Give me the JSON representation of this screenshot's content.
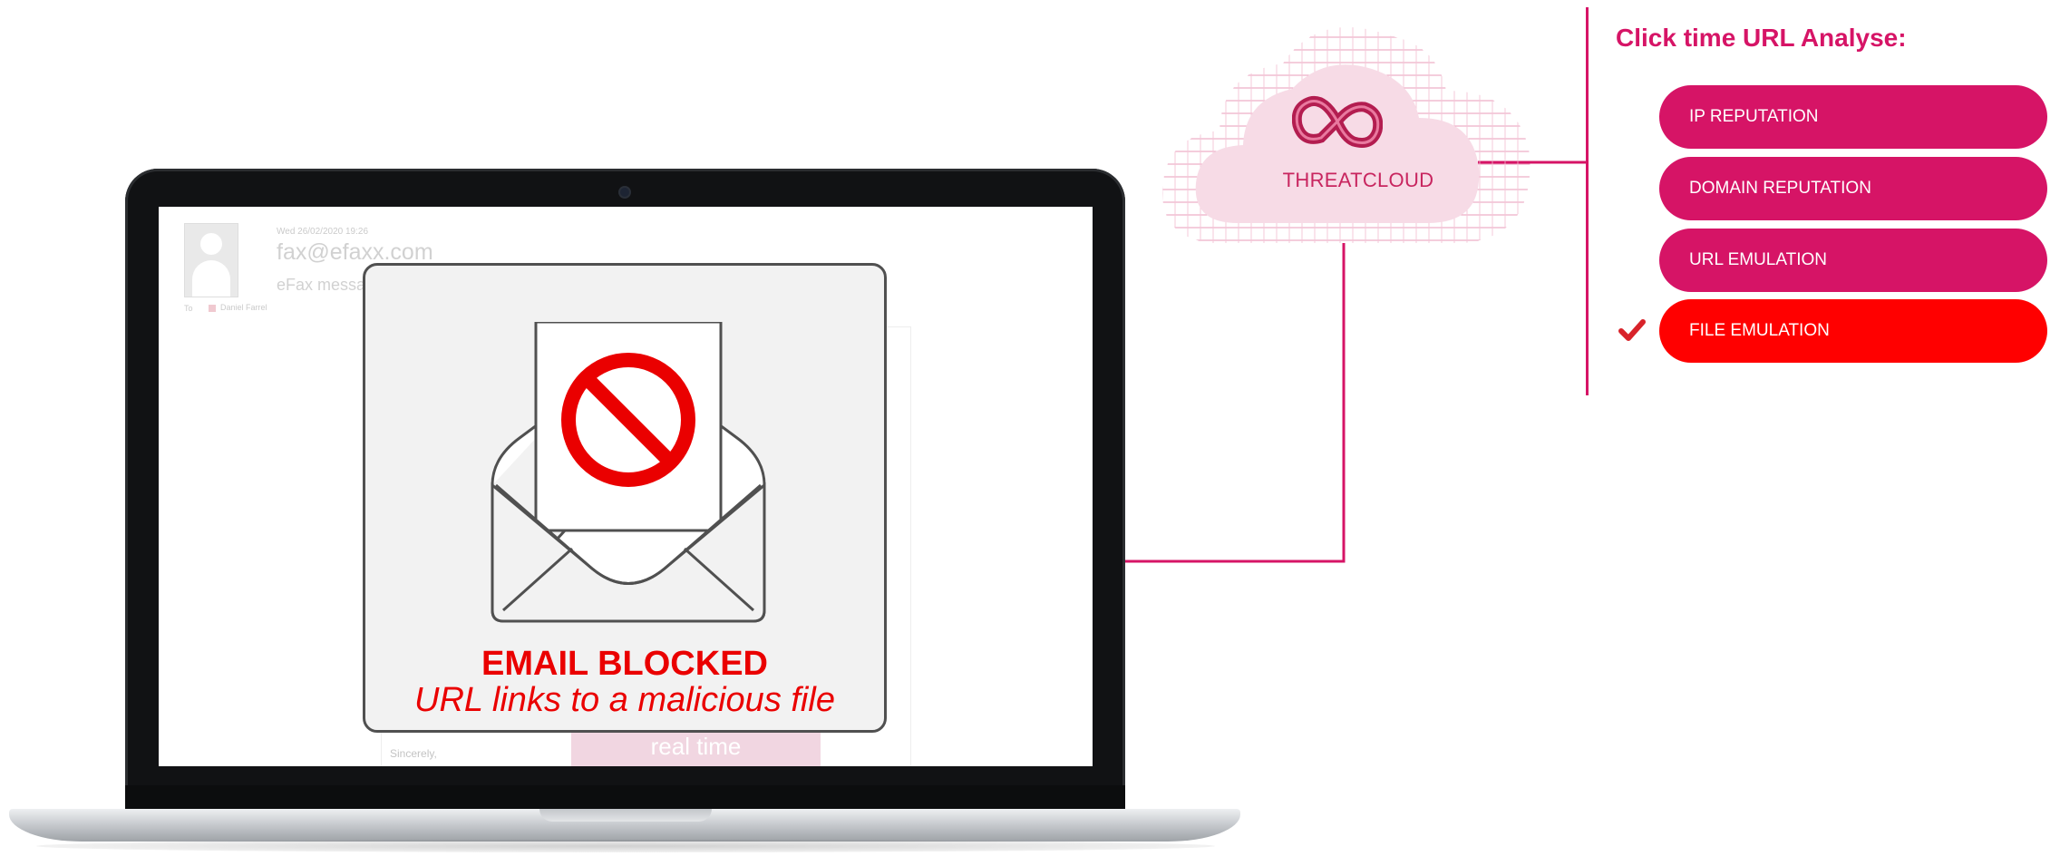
{
  "email": {
    "date": "Wed 26/02/2020 19:26",
    "from": "fax@efaxx.com",
    "subject": "eFax message",
    "to_label": "To",
    "to_name": "Daniel Farrel",
    "sign_off": "Sincerely,",
    "button_label": "real time"
  },
  "overlay": {
    "title": "EMAIL BLOCKED",
    "subtitle": "URL links to a malicious file"
  },
  "cloud": {
    "label": "THREATCLOUD"
  },
  "panel": {
    "title": "Click time URL Analyse:",
    "items": [
      {
        "label": "IP REPUTATION",
        "color": "#d61466",
        "checked": false
      },
      {
        "label": "DOMAIN REPUTATION",
        "color": "#d61466",
        "checked": false
      },
      {
        "label": "URL EMULATION",
        "color": "#d61466",
        "checked": false
      },
      {
        "label": "FILE EMULATION",
        "color": "#ff0000",
        "checked": true
      }
    ]
  },
  "colors": {
    "accent": "#d61466",
    "alert": "#ea0000",
    "check": "#d8232a"
  }
}
